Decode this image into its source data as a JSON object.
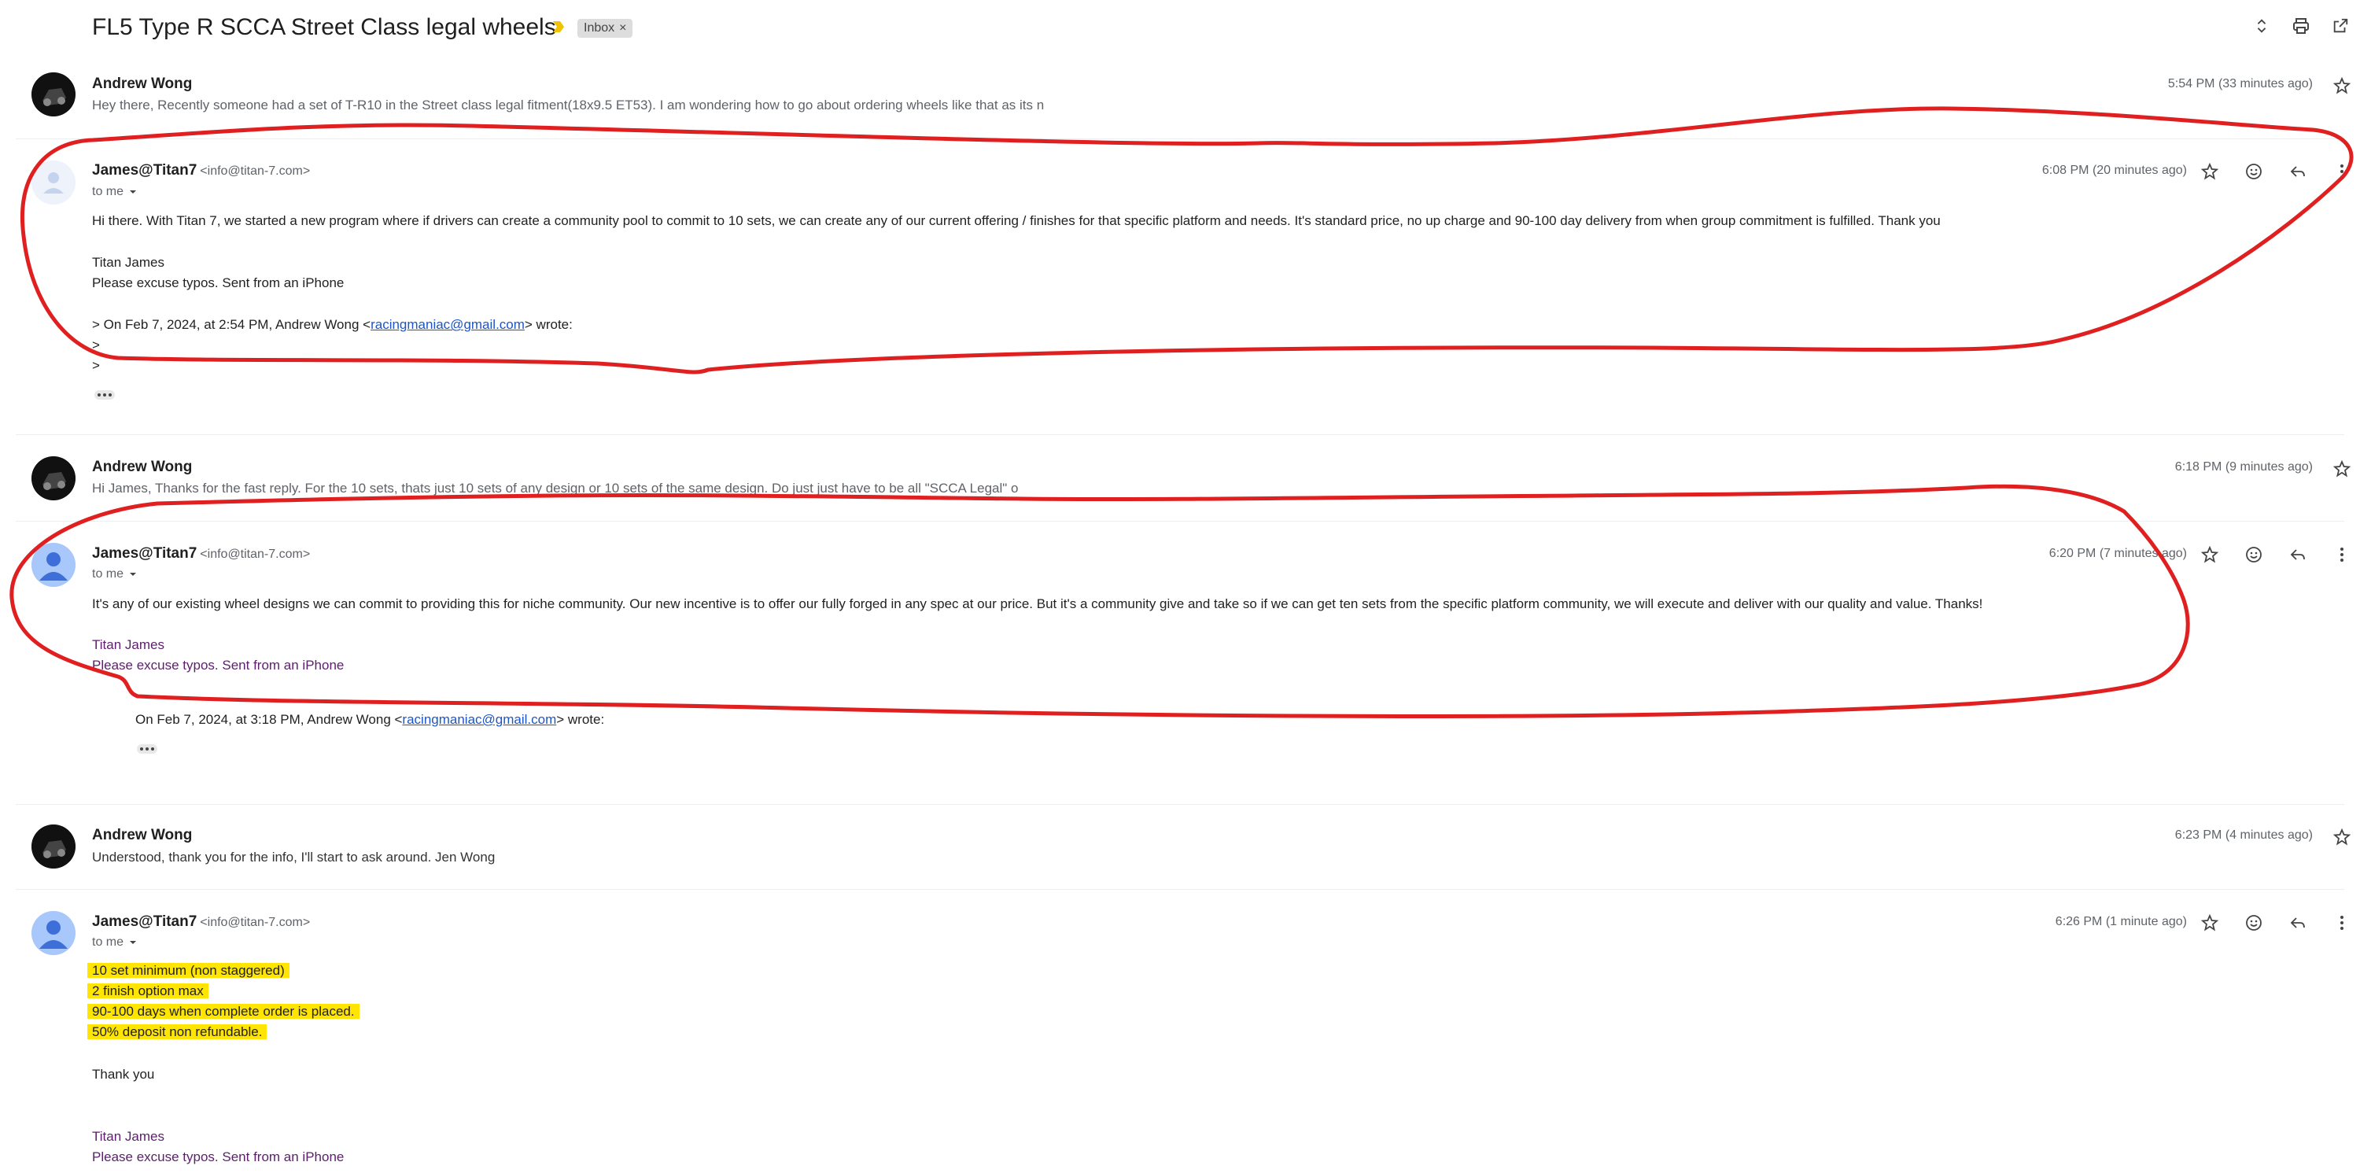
{
  "thread": {
    "subject": "FL5 Type R SCCA Street Class legal wheels",
    "label": "Inbox",
    "label_remove": "×"
  },
  "messages": [
    {
      "sender": "Andrew Wong",
      "time": "5:54 PM (33 minutes ago)",
      "snippet": "Hey there, Recently someone had a set of T-R10 in the Street class legal fitment(18x9.5 ET53). I am wondering how to go about ordering wheels like that as its n"
    },
    {
      "sender": "James@Titan7",
      "email": "<info@titan-7.com>",
      "to": "to me",
      "time": "6:08 PM (20 minutes ago)",
      "body": "Hi there. With Titan 7, we started a new program where if drivers can create a community pool to commit to 10 sets, we can create any of our current offering / finishes for that specific platform and needs. It's standard price, no up charge and 90-100 day delivery from when group commitment is fulfilled.  Thank you",
      "sig1": "Titan James",
      "sig2": "Please excuse typos. Sent from an iPhone",
      "quote_pre": "> On Feb 7, 2024, at 2:54 PM, Andrew Wong <",
      "quote_link": "racingmaniac@gmail.com",
      "quote_post": "> wrote:",
      "q1": ">",
      "q2": ">"
    },
    {
      "sender": "Andrew Wong",
      "time": "6:18 PM (9 minutes ago)",
      "snippet": "Hi James, Thanks for the fast reply. For the 10 sets, thats just 10 sets of any design or 10 sets of the same design. Do just just have to be all \"SCCA Legal\" o"
    },
    {
      "sender": "James@Titan7",
      "email": "<info@titan-7.com>",
      "to": "to me",
      "time": "6:20 PM (7 minutes ago)",
      "body": "It's any of our existing wheel designs we can commit to providing this for niche community. Our new incentive is to offer our fully forged in any spec at our price. But it's a community give and take so if we can get ten sets from the specific platform community, we will execute and deliver with our quality and value. Thanks!",
      "sig1": "Titan James",
      "sig2": "Please excuse typos. Sent from an iPhone",
      "quote_pre": "On Feb 7, 2024, at 3:18 PM, Andrew Wong <",
      "quote_link": "racingmaniac@gmail.com",
      "quote_post": "> wrote:"
    },
    {
      "sender": "Andrew Wong",
      "time": "6:23 PM (4 minutes ago)",
      "snippet": "Understood, thank you for the info, I'll start to ask around. Jen Wong"
    },
    {
      "sender": "James@Titan7",
      "email": "<info@titan-7.com>",
      "to": "to me",
      "time": "6:26 PM (1 minute ago)",
      "lines": [
        "10 set minimum (non staggered)",
        "2 finish option max",
        "90-100 days when complete order is placed.",
        "50% deposit non refundable."
      ],
      "thanks": "Thank you",
      "sig1": "Titan James",
      "sig2": "Please excuse typos. Sent from an iPhone"
    }
  ],
  "icons": {
    "expand": "unfold-icon",
    "print": "print-icon",
    "popout": "open-in-new-icon",
    "star": "star-icon",
    "emoji": "emoji-icon",
    "reply": "reply-icon",
    "more": "more-vert-icon"
  },
  "colors": {
    "annotation_red": "#e02020",
    "highlight_yellow": "#ffe500",
    "link_blue": "#1a56c9",
    "important_marker": "#f2c200"
  }
}
